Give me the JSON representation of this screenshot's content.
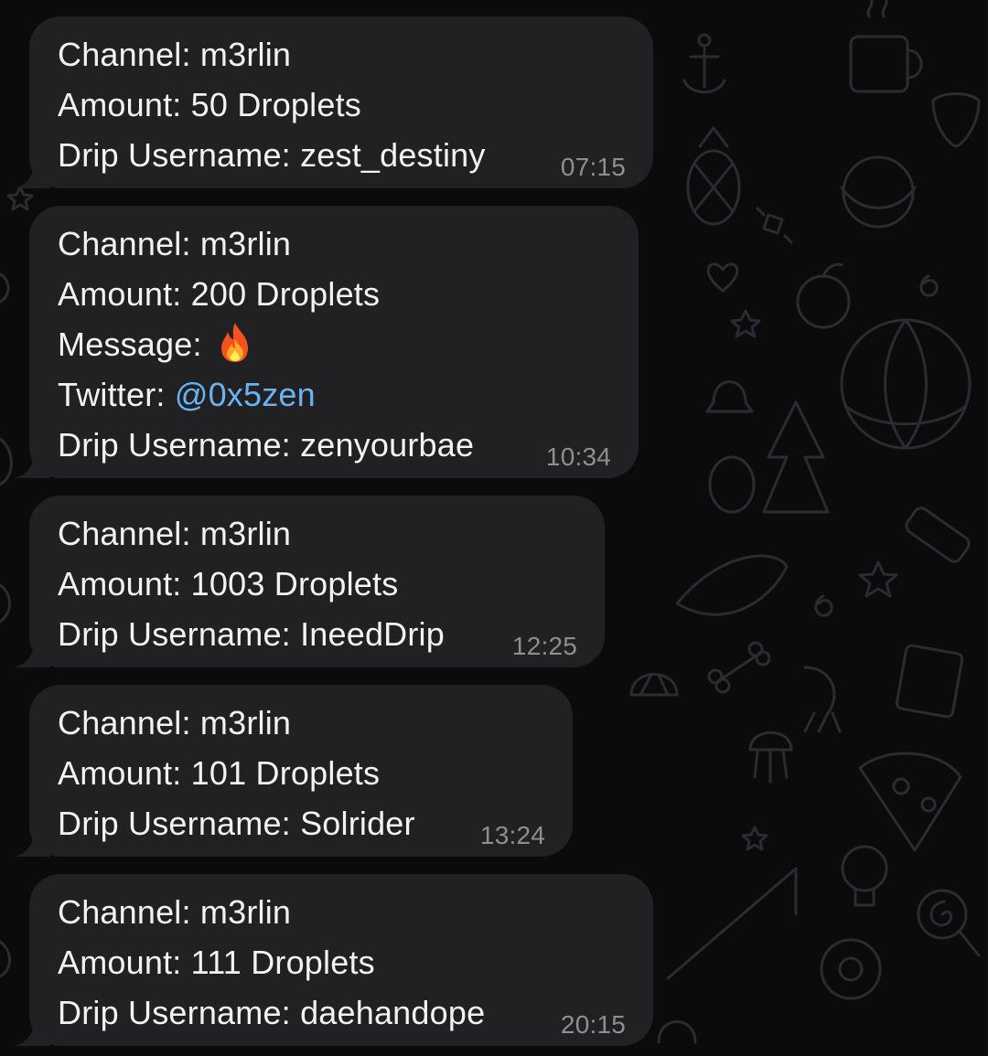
{
  "colors": {
    "background": "#0b0b0c",
    "bubble": "#212123",
    "text": "#f2f2f2",
    "timestamp": "#8e8e93",
    "link": "#6ab3f3"
  },
  "messages": [
    {
      "channel": "Channel: m3rlin",
      "amount": "Amount: 50 Droplets",
      "username": "Drip Username: zest_destiny",
      "time": "07:15"
    },
    {
      "channel": "Channel: m3rlin",
      "amount": "Amount: 200 Droplets",
      "message_label": "Message:",
      "message_emoji": "fire-icon",
      "twitter_label": "Twitter:",
      "twitter_handle": "@0x5zen",
      "username": "Drip Username: zenyourbae",
      "time": "10:34"
    },
    {
      "channel": "Channel: m3rlin",
      "amount": "Amount: 1003 Droplets",
      "username": "Drip Username: IneedDrip",
      "time": "12:25"
    },
    {
      "channel": "Channel: m3rlin",
      "amount": "Amount: 101 Droplets",
      "username": "Drip Username: Solrider",
      "time": "13:24"
    },
    {
      "channel": "Channel: m3rlin",
      "amount": "Amount: 111 Droplets",
      "username": "Drip Username: daehandope",
      "time": "20:15"
    }
  ]
}
